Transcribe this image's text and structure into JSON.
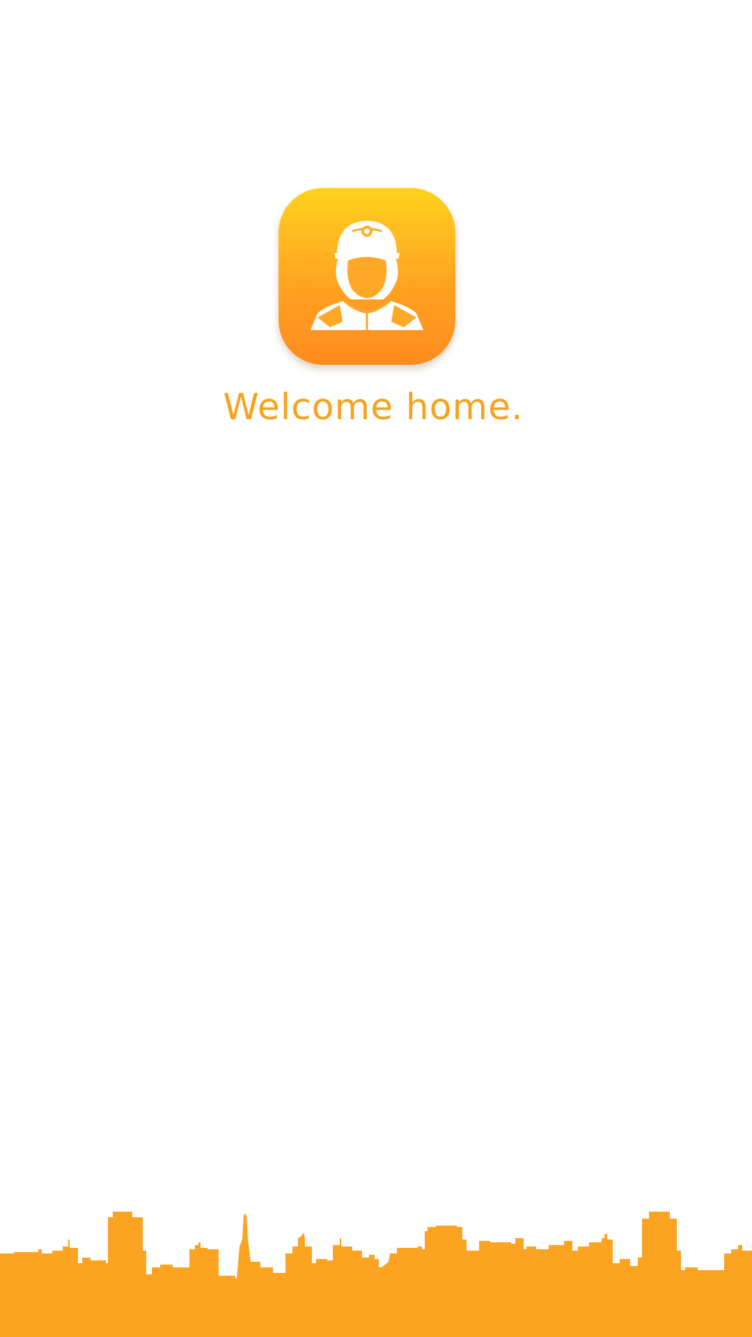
{
  "splash": {
    "welcome_text": "Welcome home."
  },
  "icons": {
    "app_icon": "firefighter-icon",
    "footer_art": "city-skyline"
  },
  "colors": {
    "brand_orange": "#F7A21E",
    "icon_gradient_top": "#FFD21E",
    "icon_gradient_bottom": "#FF8B1F",
    "skyline": "#FCA421",
    "background": "#FFFFFF"
  }
}
